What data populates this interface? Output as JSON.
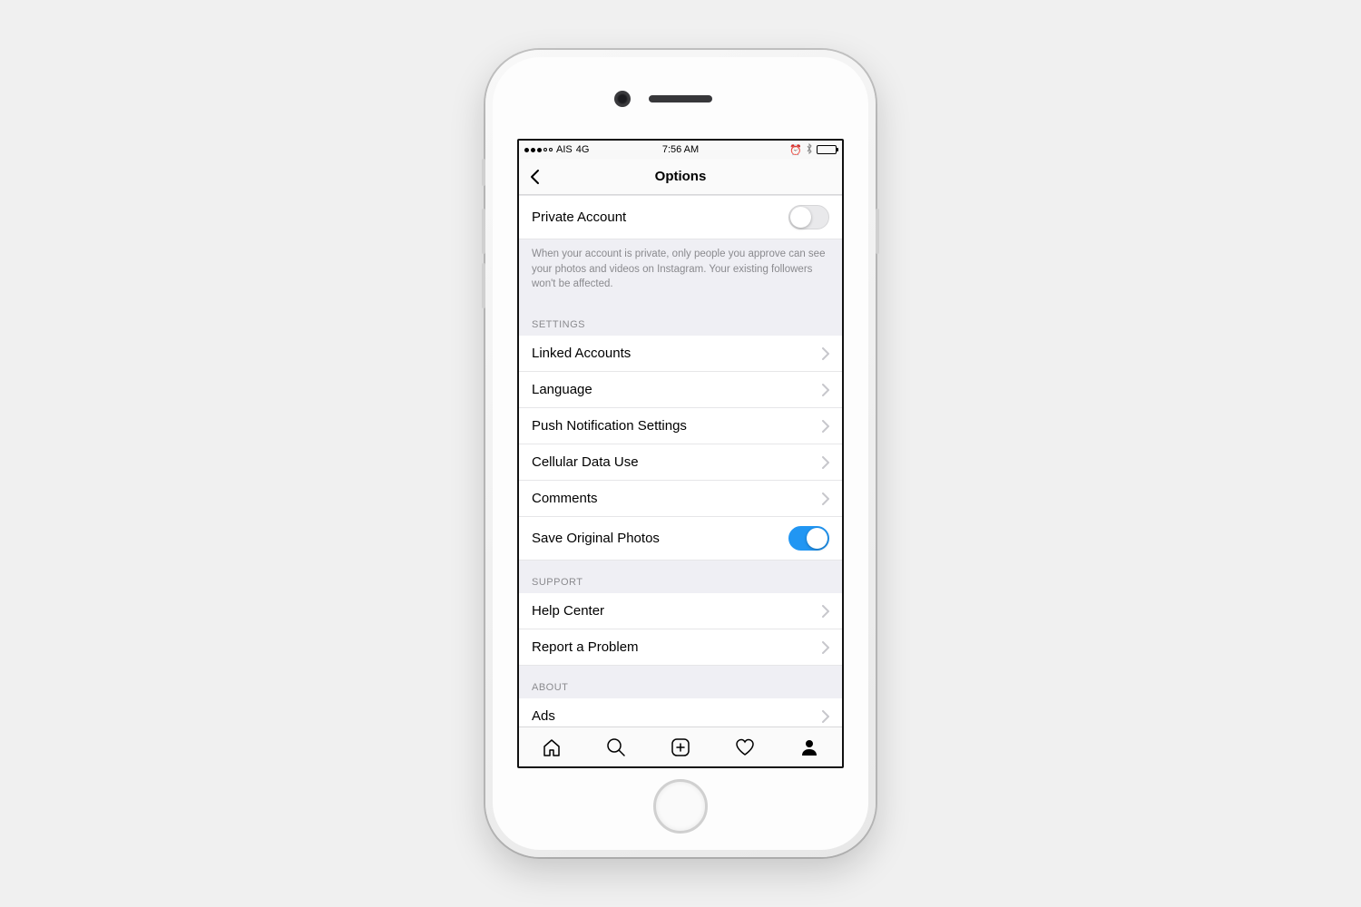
{
  "status_bar": {
    "carrier": "AIS",
    "network": "4G",
    "time": "7:56 AM",
    "signal_filled": 3,
    "signal_total": 5
  },
  "nav": {
    "title": "Options"
  },
  "private_account": {
    "label": "Private Account",
    "enabled": false,
    "description": "When your account is private, only people you approve can see your photos and videos on Instagram. Your existing followers won't be affected."
  },
  "sections": {
    "settings": {
      "header": "SETTINGS",
      "items": [
        {
          "label": "Linked Accounts"
        },
        {
          "label": "Language"
        },
        {
          "label": "Push Notification Settings"
        },
        {
          "label": "Cellular Data Use"
        },
        {
          "label": "Comments"
        }
      ],
      "save_photos": {
        "label": "Save Original Photos",
        "enabled": true
      }
    },
    "support": {
      "header": "SUPPORT",
      "items": [
        {
          "label": "Help Center"
        },
        {
          "label": "Report a Problem"
        }
      ]
    },
    "about": {
      "header": "ABOUT",
      "items": [
        {
          "label": "Ads"
        }
      ]
    }
  },
  "tabs": [
    {
      "name": "home"
    },
    {
      "name": "search"
    },
    {
      "name": "add"
    },
    {
      "name": "activity"
    },
    {
      "name": "profile"
    }
  ]
}
